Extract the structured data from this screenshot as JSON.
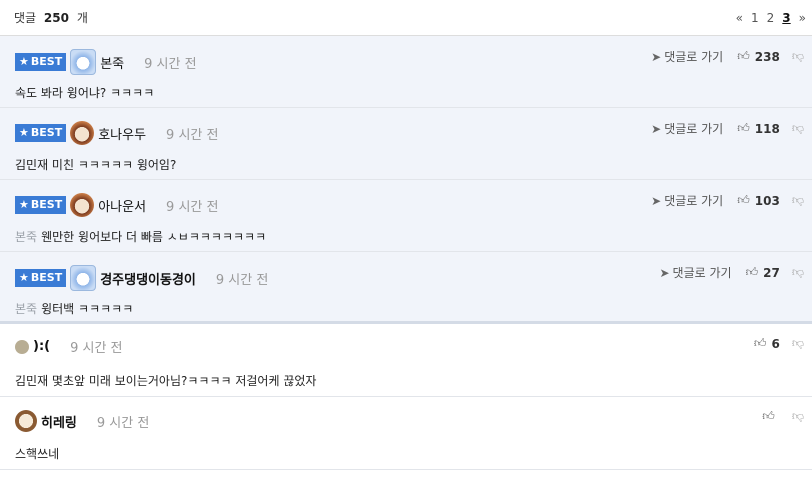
{
  "header": {
    "count_label": "댓글",
    "count": "250",
    "count_suffix": "개",
    "pager": {
      "prev": "«",
      "pages": [
        "1",
        "2",
        "3"
      ],
      "current": "3",
      "next": "»"
    }
  },
  "best_label": "BEST",
  "reply_link_label": "댓글로 가기",
  "best_comments": [
    {
      "nick": "본죽",
      "time": "9 시간 전",
      "quote": "",
      "text": "속도 봐라 윙어냐? ㅋㅋㅋㅋ",
      "likes": "238"
    },
    {
      "nick": "호나우두",
      "time": "9 시간 전",
      "quote": "",
      "text": "김민재 미친 ㅋㅋㅋㅋㅋ 윙어임?",
      "likes": "118"
    },
    {
      "nick": "아나운서",
      "time": "9 시간 전",
      "quote": "본죽",
      "text": "웬만한 윙어보다 더 빠름 ㅅㅂㅋㅋㅋㅋㅋㅋㅋ",
      "likes": "103"
    },
    {
      "nick": "경주댕댕이동경이",
      "time": "9 시간 전",
      "quote": "본죽",
      "text": "윙터백 ㅋㅋㅋㅋㅋ",
      "likes": "27"
    }
  ],
  "comments": [
    {
      "nick": "):(",
      "time": "9 시간 전",
      "text": "김민재 몇초앞 미래 보이는거아님?ㅋㅋㅋㅋ 저걸어케 끊었자",
      "likes": "6"
    },
    {
      "nick": "히레링",
      "time": "9 시간 전",
      "text": "스핵쓰네",
      "likes": ""
    }
  ]
}
